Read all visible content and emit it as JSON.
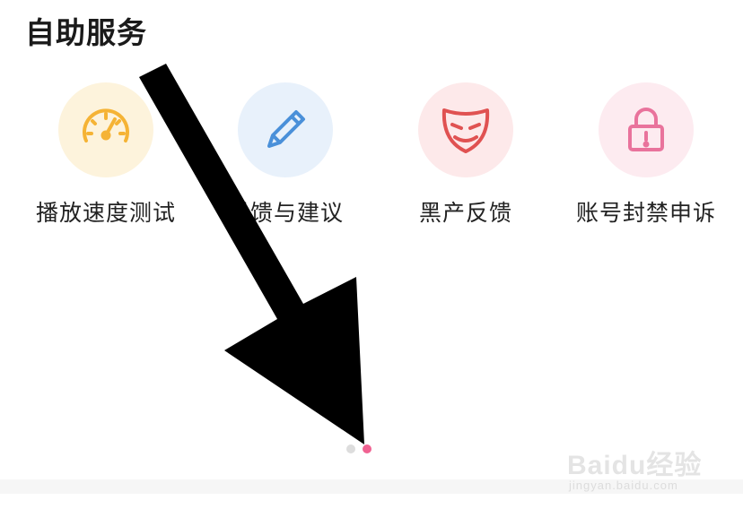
{
  "section": {
    "title": "自助服务"
  },
  "services": [
    {
      "label": "播放速度测试",
      "icon": "speedometer-icon",
      "color": "#f5b335",
      "bg": "#fdf3dc"
    },
    {
      "label": "反馈与建议",
      "icon": "pencil-icon",
      "color": "#4a90d9",
      "bg": "#e8f1fb"
    },
    {
      "label": "黑产反馈",
      "icon": "mask-icon",
      "color": "#e05252",
      "bg": "#fde9ea"
    },
    {
      "label": "账号封禁申诉",
      "icon": "lock-icon",
      "color": "#e9739c",
      "bg": "#fdebf0"
    }
  ],
  "pager": {
    "active_color": "#f06292",
    "inactive_color": "#dddddd"
  },
  "overlay": {
    "arrow_color": "#000000"
  },
  "watermark": {
    "brand": "Baidu经验",
    "url": "jingyan.baidu.com"
  }
}
